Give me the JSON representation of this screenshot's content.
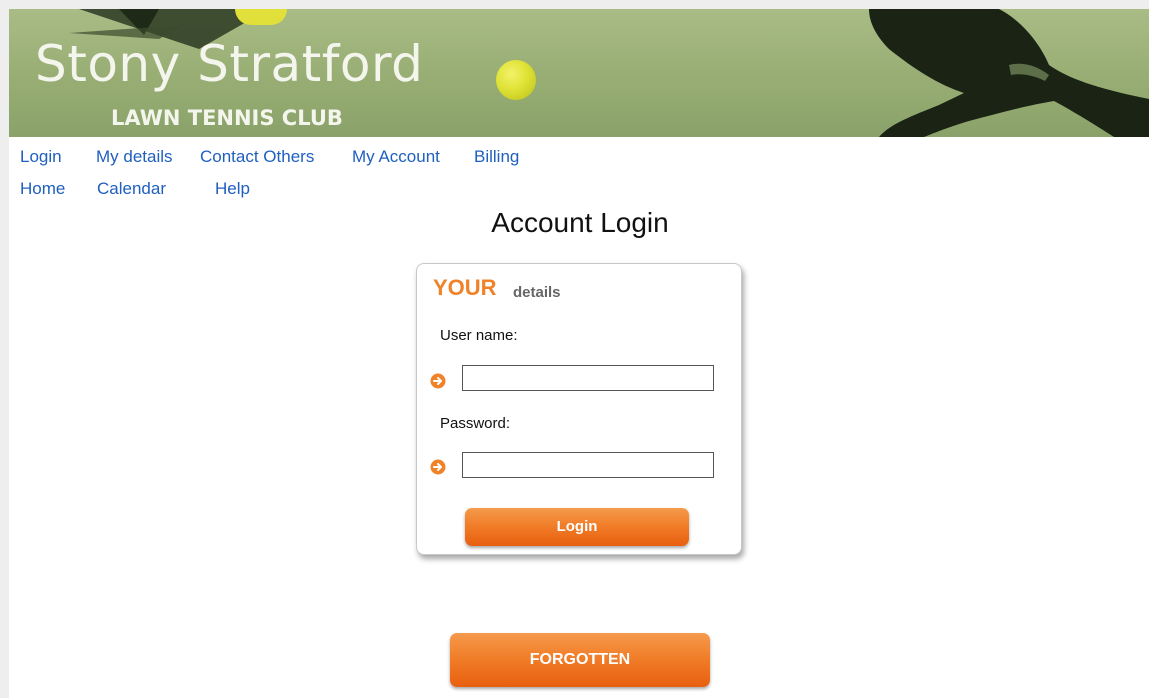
{
  "banner": {
    "title": "Stony Stratford",
    "subtitle": "LAWN TENNIS CLUB"
  },
  "nav": {
    "row1": [
      "Login",
      "My details",
      "Contact Others",
      "My Account",
      "Billing"
    ],
    "row2": [
      "Home",
      "Calendar",
      "Help"
    ]
  },
  "page": {
    "heading": "Account Login"
  },
  "login_form": {
    "title_your": "YOUR",
    "title_details": "details",
    "username_label": "User name:",
    "username_value": "",
    "password_label": "Password:",
    "password_value": "",
    "submit_label": "Login",
    "field_icon": "orange-arrow-circle-icon"
  },
  "forgotten": {
    "label": "FORGOTTEN"
  },
  "colors": {
    "link": "#1f5fbf",
    "accent_orange": "#f0832a",
    "banner_green": "#97ad73"
  }
}
